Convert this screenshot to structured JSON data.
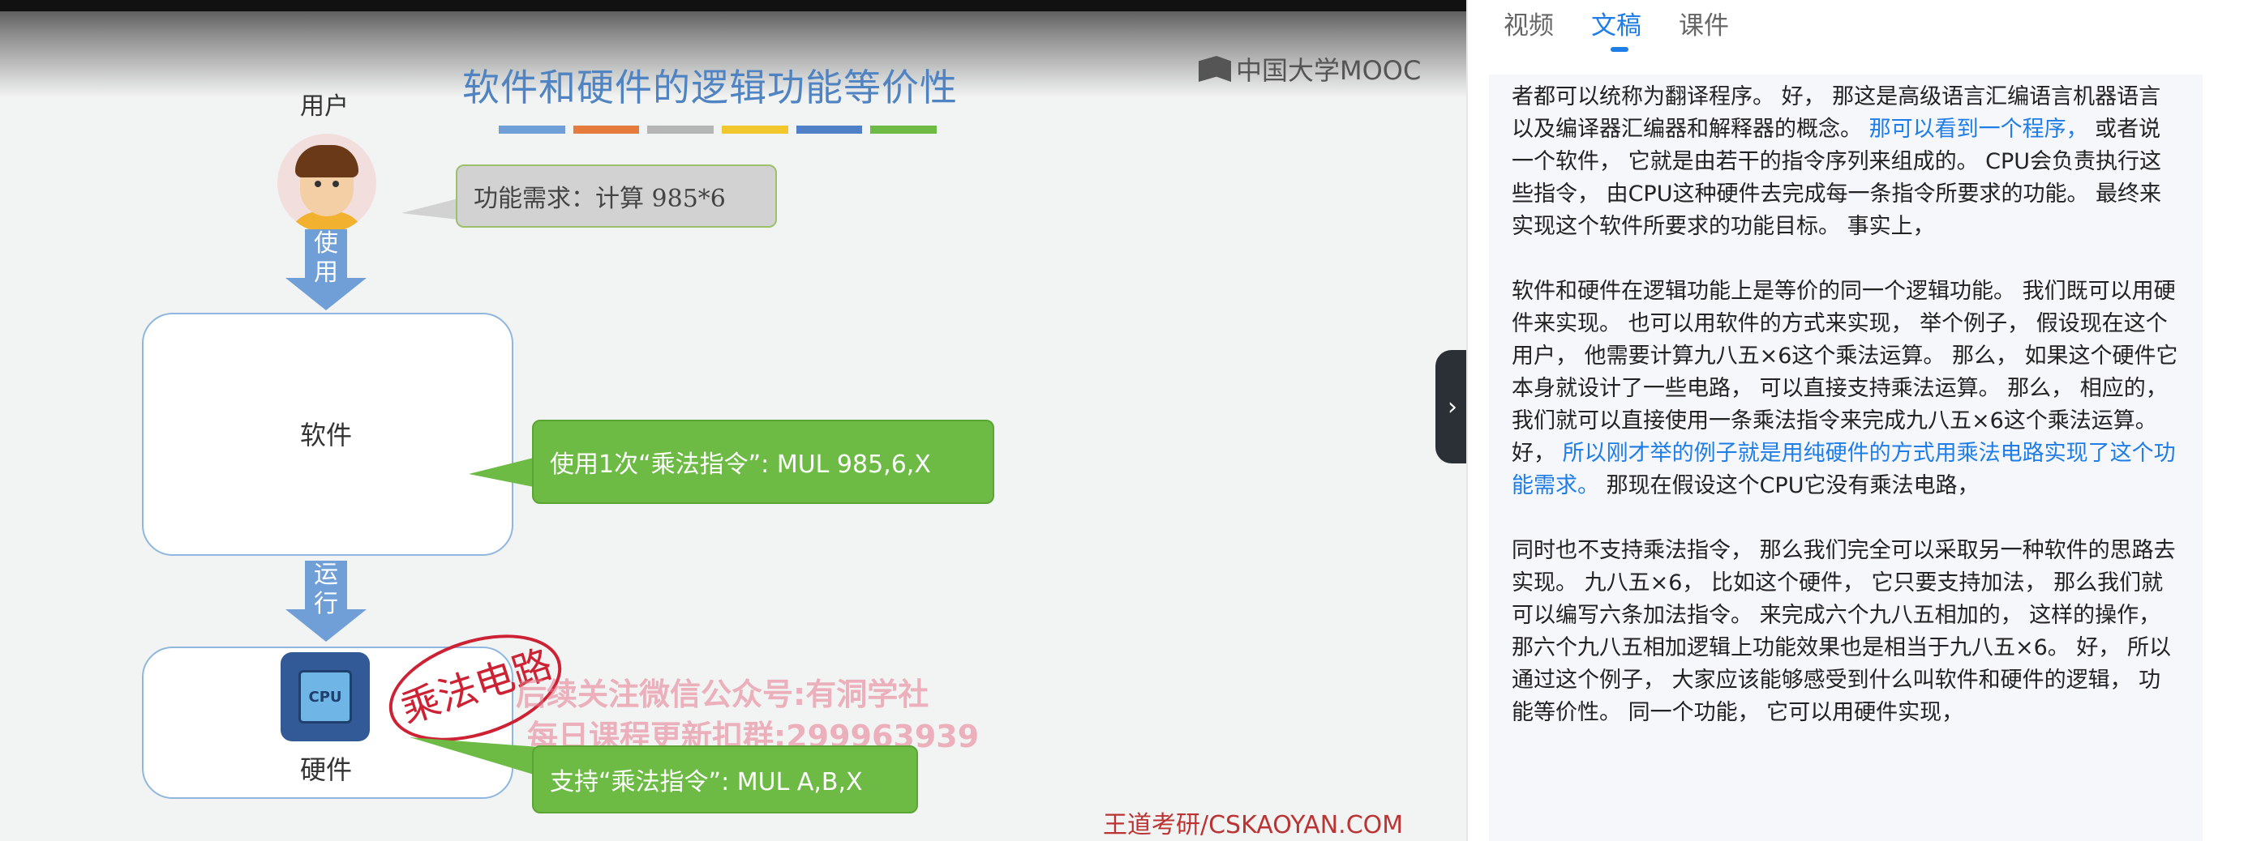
{
  "video": {
    "slide_title": "软件和硬件的逻辑功能等价性",
    "logo_text": "中国大学MOOC",
    "user_label": "用户",
    "bubble_requirement": "功能需求：计算 985*6",
    "arrow_use": [
      "使",
      "用"
    ],
    "software_label": "软件",
    "bubble_software": "使用1次“乘法指令”: MUL 985,6,X",
    "arrow_run": [
      "运",
      "行"
    ],
    "cpu_text": "CPU",
    "hardware_label": "硬件",
    "handwriting": "乘法电路",
    "watermark_line1": "后续关注微信公众号:有洞学社",
    "watermark_line2": "每日课程更新扣群:299963939",
    "bubble_hardware": "支持“乘法指令”: MUL A,B,X",
    "footer_brand": "王道考研/CSKAOYAN.COM",
    "colors": [
      "#6f9fd6",
      "#e57b3c",
      "#b5b5b5",
      "#f2c72e",
      "#4f7fc4",
      "#6dbb45"
    ],
    "collapse_icon": "chevron-right-icon"
  },
  "side": {
    "tabs": [
      {
        "label": "视频",
        "active": false
      },
      {
        "label": "文稿",
        "active": true
      },
      {
        "label": "课件",
        "active": false
      }
    ],
    "paragraphs": [
      [
        {
          "text": "者都可以统称为翻译程序。 好， 那这是高级语言汇编语言机器语言以及编译器汇编器和解释器的概念。 ",
          "hl": false
        },
        {
          "text": "那可以看到一个程序，",
          "hl": true
        },
        {
          "text": " 或者说一个软件， 它就是由若干的指令序列来组成的。 CPU会负责执行这些指令， 由CPU这种硬件去完成每一条指令所要求的功能。 最终来实现这个软件所要求的功能目标。 事实上，",
          "hl": false
        }
      ],
      [
        {
          "text": "软件和硬件在逻辑功能上是等价的同一个逻辑功能。 我们既可以用硬件来实现。 也可以用软件的方式来实现， 举个例子， 假设现在这个用户， 他需要计算九八五×6这个乘法运算。 那么， 如果这个硬件它本身就设计了一些电路， 可以直接支持乘法运算。 那么， 相应的， 我们就可以直接使用一条乘法指令来完成九八五×6这个乘法运算。 好， ",
          "hl": false
        },
        {
          "text": "所以刚才举的例子就是用纯硬件的方式用乘法电路实现了这个功能需求。",
          "hl": true
        },
        {
          "text": " 那现在假设这个CPU它没有乘法电路，",
          "hl": false
        }
      ],
      [
        {
          "text": "同时也不支持乘法指令， 那么我们完全可以采取另一种软件的思路去实现。 九八五×6， 比如这个硬件， 它只要支持加法， 那么我们就可以编写六条加法指令。 来完成六个九八五相加的， 这样的操作， 那六个九八五相加逻辑上功能效果也是相当于九八五×6。 好， 所以通过这个例子， 大家应该能够感受到什么叫软件和硬件的逻辑， 功能等价性。 同一个功能， 它可以用硬件实现，",
          "hl": false
        }
      ]
    ]
  }
}
